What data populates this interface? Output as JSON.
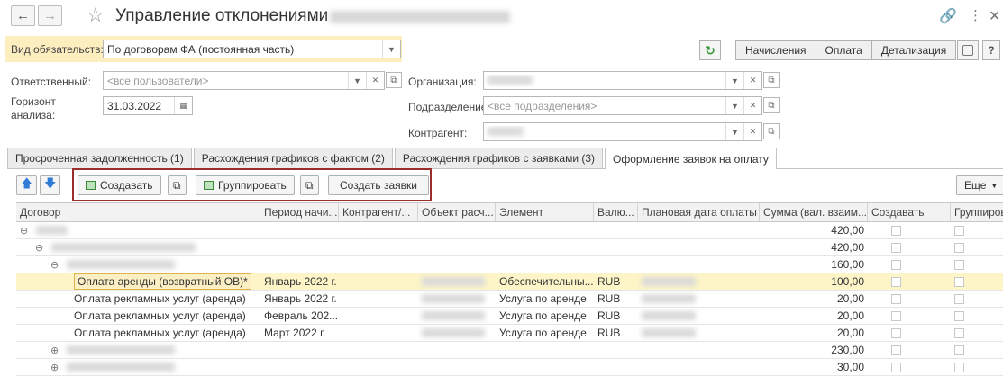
{
  "header": {
    "title": "Управление отклонениями"
  },
  "form": {
    "obligation_label": "Вид обязательств:",
    "obligation_value": "По договорам ФА (постоянная часть)",
    "responsible_label": "Ответственный:",
    "responsible_placeholder": "<все пользователи>",
    "horizon_label_1": "Горизонт",
    "horizon_label_2": "анализа:",
    "horizon_value": "31.03.2022",
    "organization_label": "Организация:",
    "department_label": "Подразделение:",
    "department_placeholder": "<все подразделения>",
    "counterparty_label": "Контрагент:"
  },
  "view_switch": [
    "Начисления",
    "Оплата",
    "Детализация"
  ],
  "tabs": [
    "Просроченная задолженность (1)",
    "Расхождения графиков с фактом (2)",
    "Расхождения графиков с заявками (3)",
    "Оформление заявок на оплату"
  ],
  "toolbar": {
    "create": "Создавать",
    "group": "Группировать",
    "create_requests": "Создать заявки",
    "more": "Еще"
  },
  "table": {
    "columns": [
      "Договор",
      "Период начи...",
      "Контрагент/...",
      "Объект расч...",
      "Элемент",
      "Валю...",
      "Плановая дата оплаты",
      "Сумма (вал. взаим...",
      "Создавать",
      "Группиров"
    ],
    "rows": [
      {
        "level": 0,
        "name": "",
        "period": "",
        "element": "",
        "currency": "",
        "sum": "420,00"
      },
      {
        "level": 1,
        "name": "",
        "period": "",
        "element": "",
        "currency": "",
        "sum": "420,00"
      },
      {
        "level": 2,
        "name": "",
        "period": "",
        "element": "",
        "currency": "",
        "sum": "160,00"
      },
      {
        "level": 3,
        "name": "Оплата аренды (возвратный ОВ)*",
        "period": "Январь 2022 г.",
        "element": "Обеспечительны...",
        "currency": "RUB",
        "sum": "100,00"
      },
      {
        "level": 3,
        "name": "Оплата рекламных услуг (аренда)",
        "period": "Январь 2022 г.",
        "element": "Услуга по аренде",
        "currency": "RUB",
        "sum": "20,00"
      },
      {
        "level": 3,
        "name": "Оплата рекламных услуг (аренда)",
        "period": "Февраль 202...",
        "element": "Услуга по аренде",
        "currency": "RUB",
        "sum": "20,00"
      },
      {
        "level": 3,
        "name": "Оплата рекламных услуг (аренда)",
        "period": "Март 2022 г.",
        "element": "Услуга по аренде",
        "currency": "RUB",
        "sum": "20,00"
      },
      {
        "level": 2,
        "name": "",
        "period": "",
        "element": "",
        "currency": "",
        "sum": "230,00"
      },
      {
        "level": 2,
        "name": "",
        "period": "",
        "element": "",
        "currency": "",
        "sum": "30,00"
      }
    ]
  }
}
